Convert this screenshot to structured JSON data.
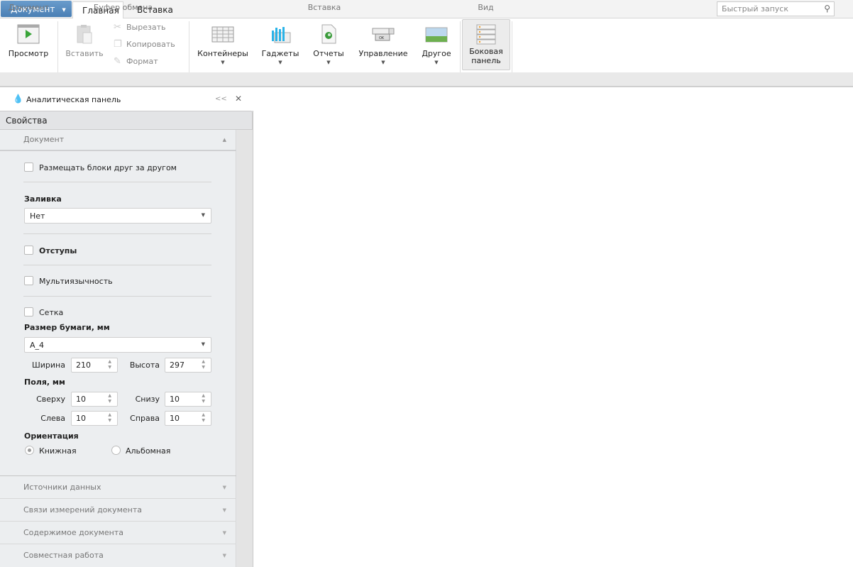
{
  "topbar": {
    "doc_menu": "Документ",
    "tabs": [
      {
        "label": "Главная",
        "active": true
      },
      {
        "label": "Вставка",
        "active": false
      }
    ],
    "search_placeholder": "Быстрый запуск"
  },
  "ribbon": {
    "groups": [
      {
        "label": "Документ"
      },
      {
        "label": "Буфер обмена"
      },
      {
        "label": "Вставка"
      },
      {
        "label": "Вид"
      }
    ],
    "preview": "Просмотр",
    "paste": "Вставить",
    "cut": "Вырезать",
    "copy": "Копировать",
    "format": "Формат",
    "containers": "Контейнеры",
    "gadgets": "Гаджеты",
    "reports": "Отчеты",
    "controls": "Управление",
    "other": "Другое",
    "sidepanel_line1": "Боковая",
    "sidepanel_line2": "панель"
  },
  "panel": {
    "title": "Аналитическая панель",
    "collapse": "<<",
    "close": "✕",
    "tab": "Свойства",
    "section": "Документ",
    "place_blocks": "Размещать блоки друг за другом",
    "fill_label": "Заливка",
    "fill_value": "Нет",
    "indents": "Отступы",
    "multilang": "Мультиязычность",
    "grid": "Сетка",
    "paper_label": "Размер бумаги, мм",
    "paper_value": "A_4",
    "width_label": "Ширина",
    "width_value": "210",
    "height_label": "Высота",
    "height_value": "297",
    "margins_label": "Поля, мм",
    "top_label": "Сверху",
    "top_value": "10",
    "bottom_label": "Снизу",
    "bottom_value": "10",
    "left_label": "Слева",
    "left_value": "10",
    "right_label": "Справа",
    "right_value": "10",
    "orientation_label": "Ориентация",
    "portrait": "Книжная",
    "landscape": "Альбомная",
    "collapsed": [
      "Источники данных",
      "Связи измерений документа",
      "Содержимое документа",
      "Совместная работа"
    ]
  }
}
